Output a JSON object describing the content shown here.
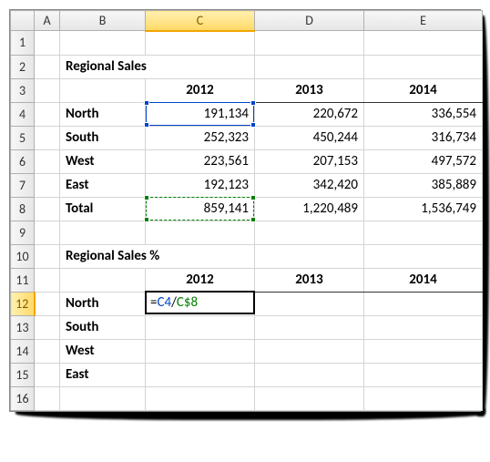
{
  "columns": {
    "A": "A",
    "B": "B",
    "C": "C",
    "D": "D",
    "E": "E"
  },
  "rows": [
    "1",
    "2",
    "3",
    "4",
    "5",
    "6",
    "7",
    "8",
    "9",
    "10",
    "11",
    "12",
    "13",
    "14",
    "15",
    "16"
  ],
  "titles": {
    "sales": "Regional Sales",
    "percent": "Regional Sales %"
  },
  "years": {
    "y1": "2012",
    "y2": "2013",
    "y3": "2014"
  },
  "regions": {
    "north": "North",
    "south": "South",
    "west": "West",
    "east": "East",
    "total": "Total"
  },
  "sales": {
    "north": {
      "y1": "191,134",
      "y2": "220,672",
      "y3": "336,554"
    },
    "south": {
      "y1": "252,323",
      "y2": "450,244",
      "y3": "316,734"
    },
    "west": {
      "y1": "223,561",
      "y2": "207,153",
      "y3": "497,572"
    },
    "east": {
      "y1": "192,123",
      "y2": "342,420",
      "y3": "385,889"
    },
    "total": {
      "y1": "859,141",
      "y2": "1,220,489",
      "y3": "1,536,749"
    }
  },
  "formula": {
    "eq": "=",
    "ref1": "C4",
    "slash": "/",
    "ref2": "C$8"
  },
  "active_col": "C",
  "active_row": "12",
  "chart_data": {
    "type": "table",
    "title": "Regional Sales",
    "categories": [
      "2012",
      "2013",
      "2014"
    ],
    "series": [
      {
        "name": "North",
        "values": [
          191134,
          220672,
          336554
        ]
      },
      {
        "name": "South",
        "values": [
          252323,
          450244,
          316734
        ]
      },
      {
        "name": "West",
        "values": [
          223561,
          207153,
          497572
        ]
      },
      {
        "name": "East",
        "values": [
          192123,
          342420,
          385889
        ]
      },
      {
        "name": "Total",
        "values": [
          859141,
          1220489,
          1536749
        ]
      }
    ]
  }
}
